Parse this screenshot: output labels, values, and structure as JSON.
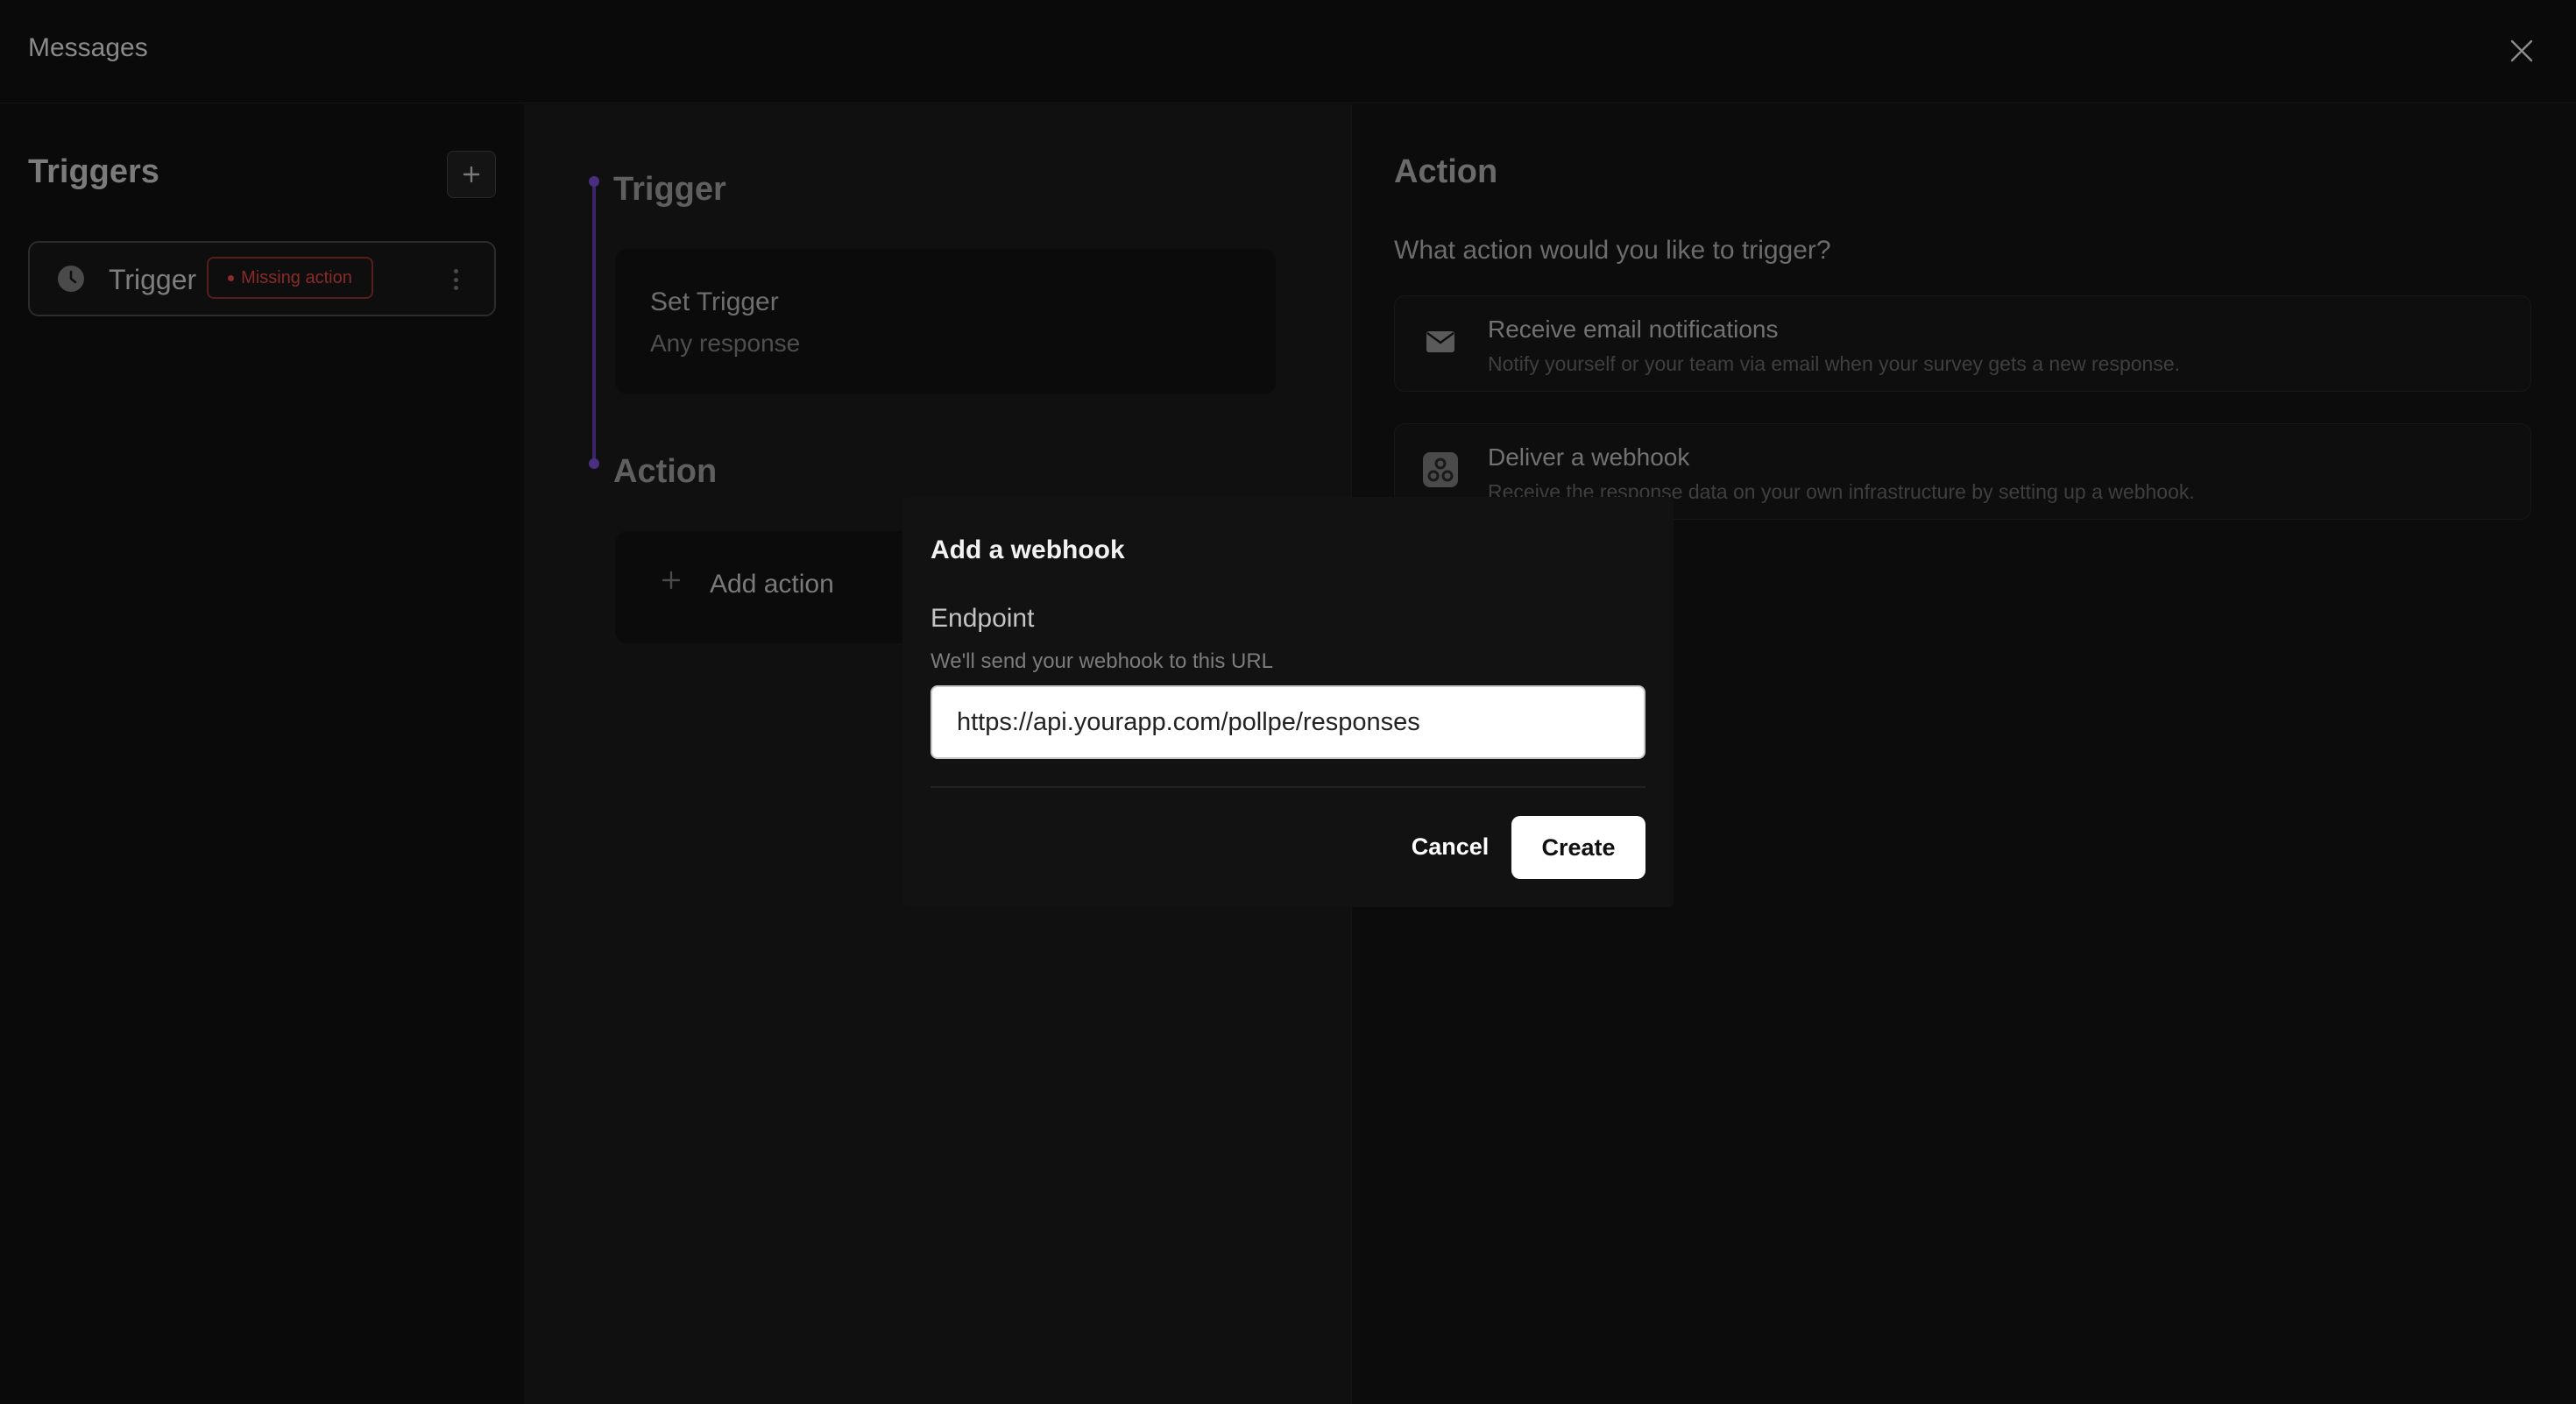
{
  "header": {
    "title": "Messages",
    "close_icon": "close-icon"
  },
  "sidebar": {
    "heading": "Triggers",
    "add_icon": "plus-icon",
    "items": [
      {
        "label": "Trigger",
        "icon": "clock-icon",
        "badge": "Missing action",
        "menu_icon": "more-vertical-icon"
      }
    ]
  },
  "flow": {
    "trigger_heading": "Trigger",
    "trigger_card": {
      "title": "Set Trigger",
      "subtitle": "Any response"
    },
    "action_heading": "Action",
    "add_action_label": "Add action"
  },
  "actions_panel": {
    "heading": "Action",
    "question": "What action would you like to trigger?",
    "options": [
      {
        "title": "Receive email notifications",
        "description": "Notify yourself or your team via email when your survey gets a new response.",
        "icon": "mail-icon"
      },
      {
        "title": "Deliver a webhook",
        "description": "Receive the response data on your own infrastructure by setting up a webhook.",
        "icon": "webhook-icon"
      }
    ]
  },
  "modal": {
    "title": "Add a webhook",
    "field_label": "Endpoint",
    "hint": "We'll send your webhook to this URL",
    "endpoint_value": "https://api.yourapp.com/pollpe/responses",
    "cancel_label": "Cancel",
    "create_label": "Create"
  },
  "colors": {
    "background": "#0a0a0a",
    "modal_background": "#121212",
    "accent_timeline": "#3b2566",
    "badge_red": "#8a2a2a"
  }
}
